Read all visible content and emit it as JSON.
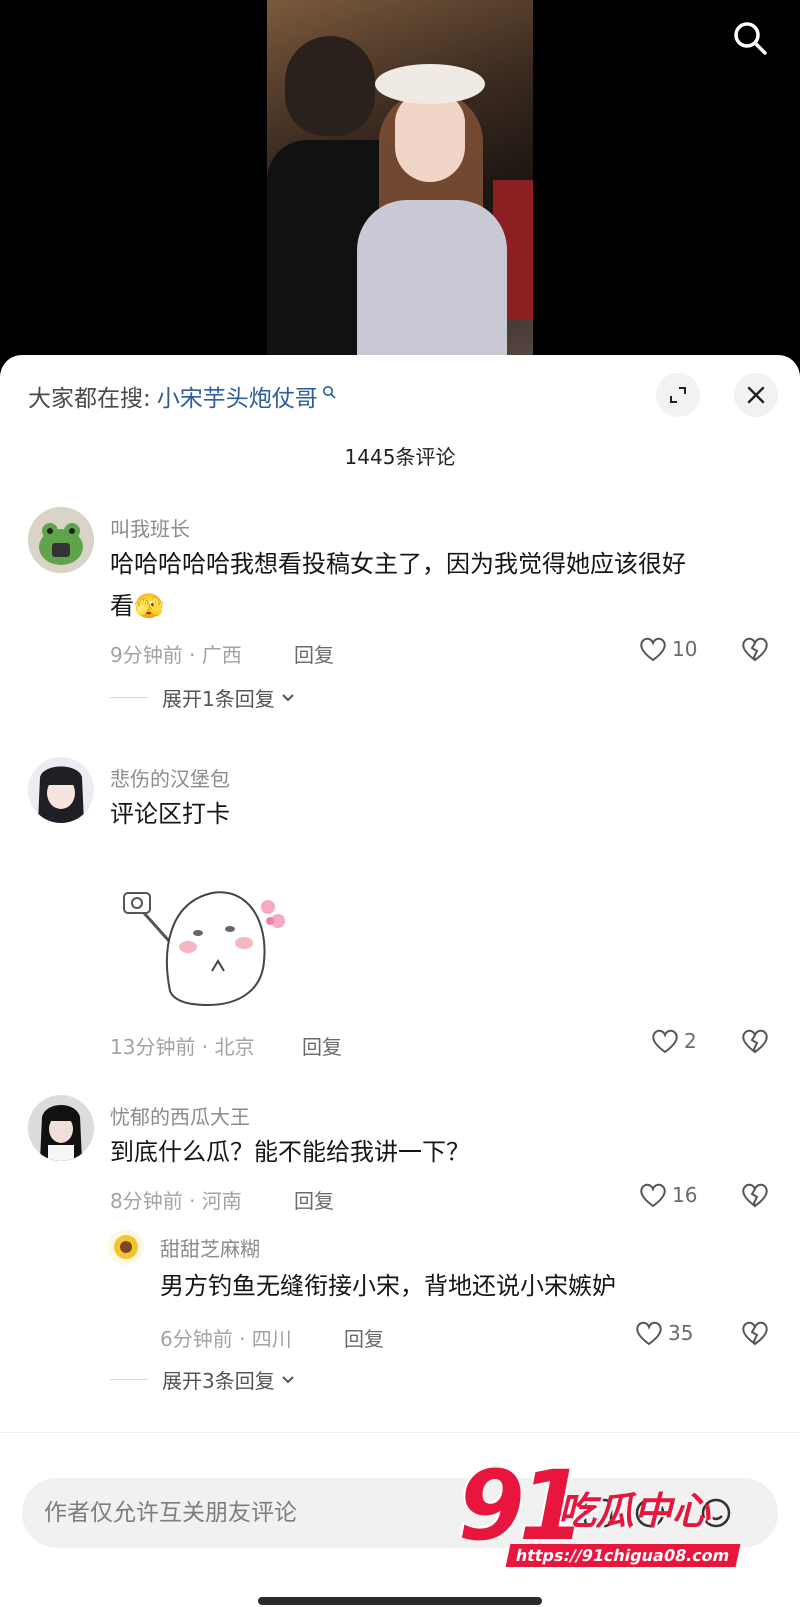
{
  "video": {
    "search_icon": "search-icon"
  },
  "header": {
    "everyone_searching": "大家都在搜:",
    "search_term": "小宋芋头炮仗哥",
    "expand_icon": "expand-icon",
    "close_icon": "close-icon"
  },
  "comment_count": "1445条评论",
  "comments": [
    {
      "username": "叫我班长",
      "text_line1": "哈哈哈哈哈我想看投稿女主了，因为我觉得她应该很好",
      "text_line2": "看🫣",
      "meta": "9分钟前 · 广西",
      "reply": "回复",
      "likes": "10",
      "expand": "展开1条回复"
    },
    {
      "username": "悲伤的汉堡包",
      "text": "评论区打卡",
      "sticker": "selfie-bun-sticker",
      "meta": "13分钟前 · 北京",
      "reply": "回复",
      "likes": "2"
    },
    {
      "username": "忧郁的西瓜大王",
      "text": "到底什么瓜？能不能给我讲一下？",
      "meta": "8分钟前 · 河南",
      "reply": "回复",
      "likes": "16",
      "sub_reply": {
        "username": "甜甜芝麻糊",
        "text": "男方钓鱼无缝衔接小宋，背地还说小宋嫉妒",
        "meta": "6分钟前 · 四川",
        "reply": "回复",
        "likes": "35"
      },
      "expand": "展开3条回复"
    }
  ],
  "input": {
    "placeholder": "作者仅允许互关朋友评论"
  },
  "watermark": {
    "num": "91",
    "word": "吃瓜中心",
    "url": "https://91chigua08.com"
  },
  "colors": {
    "link": "#2d5d9a",
    "watermark": "#e8163c"
  }
}
